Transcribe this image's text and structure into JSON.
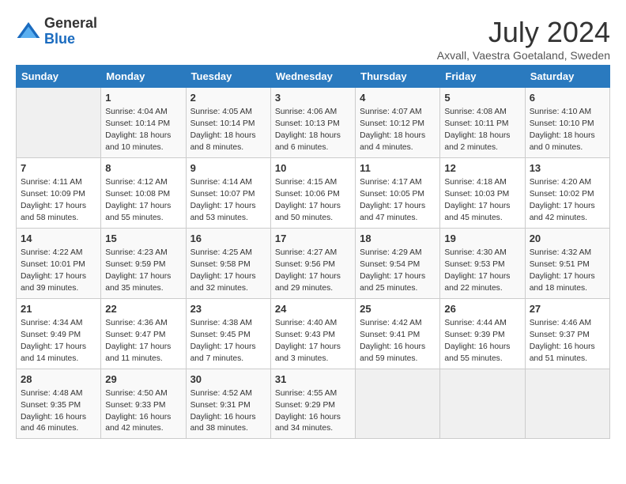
{
  "header": {
    "logo_general": "General",
    "logo_blue": "Blue",
    "month_title": "July 2024",
    "subtitle": "Axvall, Vaestra Goetaland, Sweden"
  },
  "days_of_week": [
    "Sunday",
    "Monday",
    "Tuesday",
    "Wednesday",
    "Thursday",
    "Friday",
    "Saturday"
  ],
  "weeks": [
    [
      {
        "day": "",
        "empty": true
      },
      {
        "day": "1",
        "sunrise": "Sunrise: 4:04 AM",
        "sunset": "Sunset: 10:14 PM",
        "daylight": "Daylight: 18 hours and 10 minutes."
      },
      {
        "day": "2",
        "sunrise": "Sunrise: 4:05 AM",
        "sunset": "Sunset: 10:14 PM",
        "daylight": "Daylight: 18 hours and 8 minutes."
      },
      {
        "day": "3",
        "sunrise": "Sunrise: 4:06 AM",
        "sunset": "Sunset: 10:13 PM",
        "daylight": "Daylight: 18 hours and 6 minutes."
      },
      {
        "day": "4",
        "sunrise": "Sunrise: 4:07 AM",
        "sunset": "Sunset: 10:12 PM",
        "daylight": "Daylight: 18 hours and 4 minutes."
      },
      {
        "day": "5",
        "sunrise": "Sunrise: 4:08 AM",
        "sunset": "Sunset: 10:11 PM",
        "daylight": "Daylight: 18 hours and 2 minutes."
      },
      {
        "day": "6",
        "sunrise": "Sunrise: 4:10 AM",
        "sunset": "Sunset: 10:10 PM",
        "daylight": "Daylight: 18 hours and 0 minutes."
      }
    ],
    [
      {
        "day": "7",
        "sunrise": "Sunrise: 4:11 AM",
        "sunset": "Sunset: 10:09 PM",
        "daylight": "Daylight: 17 hours and 58 minutes."
      },
      {
        "day": "8",
        "sunrise": "Sunrise: 4:12 AM",
        "sunset": "Sunset: 10:08 PM",
        "daylight": "Daylight: 17 hours and 55 minutes."
      },
      {
        "day": "9",
        "sunrise": "Sunrise: 4:14 AM",
        "sunset": "Sunset: 10:07 PM",
        "daylight": "Daylight: 17 hours and 53 minutes."
      },
      {
        "day": "10",
        "sunrise": "Sunrise: 4:15 AM",
        "sunset": "Sunset: 10:06 PM",
        "daylight": "Daylight: 17 hours and 50 minutes."
      },
      {
        "day": "11",
        "sunrise": "Sunrise: 4:17 AM",
        "sunset": "Sunset: 10:05 PM",
        "daylight": "Daylight: 17 hours and 47 minutes."
      },
      {
        "day": "12",
        "sunrise": "Sunrise: 4:18 AM",
        "sunset": "Sunset: 10:03 PM",
        "daylight": "Daylight: 17 hours and 45 minutes."
      },
      {
        "day": "13",
        "sunrise": "Sunrise: 4:20 AM",
        "sunset": "Sunset: 10:02 PM",
        "daylight": "Daylight: 17 hours and 42 minutes."
      }
    ],
    [
      {
        "day": "14",
        "sunrise": "Sunrise: 4:22 AM",
        "sunset": "Sunset: 10:01 PM",
        "daylight": "Daylight: 17 hours and 39 minutes."
      },
      {
        "day": "15",
        "sunrise": "Sunrise: 4:23 AM",
        "sunset": "Sunset: 9:59 PM",
        "daylight": "Daylight: 17 hours and 35 minutes."
      },
      {
        "day": "16",
        "sunrise": "Sunrise: 4:25 AM",
        "sunset": "Sunset: 9:58 PM",
        "daylight": "Daylight: 17 hours and 32 minutes."
      },
      {
        "day": "17",
        "sunrise": "Sunrise: 4:27 AM",
        "sunset": "Sunset: 9:56 PM",
        "daylight": "Daylight: 17 hours and 29 minutes."
      },
      {
        "day": "18",
        "sunrise": "Sunrise: 4:29 AM",
        "sunset": "Sunset: 9:54 PM",
        "daylight": "Daylight: 17 hours and 25 minutes."
      },
      {
        "day": "19",
        "sunrise": "Sunrise: 4:30 AM",
        "sunset": "Sunset: 9:53 PM",
        "daylight": "Daylight: 17 hours and 22 minutes."
      },
      {
        "day": "20",
        "sunrise": "Sunrise: 4:32 AM",
        "sunset": "Sunset: 9:51 PM",
        "daylight": "Daylight: 17 hours and 18 minutes."
      }
    ],
    [
      {
        "day": "21",
        "sunrise": "Sunrise: 4:34 AM",
        "sunset": "Sunset: 9:49 PM",
        "daylight": "Daylight: 17 hours and 14 minutes."
      },
      {
        "day": "22",
        "sunrise": "Sunrise: 4:36 AM",
        "sunset": "Sunset: 9:47 PM",
        "daylight": "Daylight: 17 hours and 11 minutes."
      },
      {
        "day": "23",
        "sunrise": "Sunrise: 4:38 AM",
        "sunset": "Sunset: 9:45 PM",
        "daylight": "Daylight: 17 hours and 7 minutes."
      },
      {
        "day": "24",
        "sunrise": "Sunrise: 4:40 AM",
        "sunset": "Sunset: 9:43 PM",
        "daylight": "Daylight: 17 hours and 3 minutes."
      },
      {
        "day": "25",
        "sunrise": "Sunrise: 4:42 AM",
        "sunset": "Sunset: 9:41 PM",
        "daylight": "Daylight: 16 hours and 59 minutes."
      },
      {
        "day": "26",
        "sunrise": "Sunrise: 4:44 AM",
        "sunset": "Sunset: 9:39 PM",
        "daylight": "Daylight: 16 hours and 55 minutes."
      },
      {
        "day": "27",
        "sunrise": "Sunrise: 4:46 AM",
        "sunset": "Sunset: 9:37 PM",
        "daylight": "Daylight: 16 hours and 51 minutes."
      }
    ],
    [
      {
        "day": "28",
        "sunrise": "Sunrise: 4:48 AM",
        "sunset": "Sunset: 9:35 PM",
        "daylight": "Daylight: 16 hours and 46 minutes."
      },
      {
        "day": "29",
        "sunrise": "Sunrise: 4:50 AM",
        "sunset": "Sunset: 9:33 PM",
        "daylight": "Daylight: 16 hours and 42 minutes."
      },
      {
        "day": "30",
        "sunrise": "Sunrise: 4:52 AM",
        "sunset": "Sunset: 9:31 PM",
        "daylight": "Daylight: 16 hours and 38 minutes."
      },
      {
        "day": "31",
        "sunrise": "Sunrise: 4:55 AM",
        "sunset": "Sunset: 9:29 PM",
        "daylight": "Daylight: 16 hours and 34 minutes."
      },
      {
        "day": "",
        "empty": true
      },
      {
        "day": "",
        "empty": true
      },
      {
        "day": "",
        "empty": true
      }
    ]
  ]
}
